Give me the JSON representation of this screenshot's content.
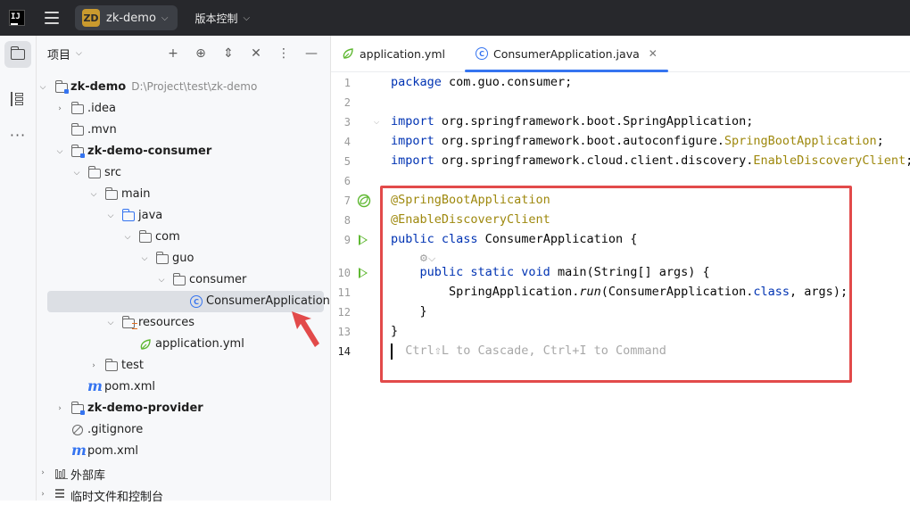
{
  "titlebar": {
    "logo": "IJ",
    "project_badge": "ZD",
    "project_name": "zk-demo",
    "vcs_label": "版本控制"
  },
  "panel": {
    "title": "项目"
  },
  "tree": [
    {
      "label": "zk-demo",
      "path": "D:\\Project\\test\\zk-demo"
    },
    {
      "label": ".idea"
    },
    {
      "label": ".mvn"
    },
    {
      "label": "zk-demo-consumer"
    },
    {
      "label": "src"
    },
    {
      "label": "main"
    },
    {
      "label": "java"
    },
    {
      "label": "com"
    },
    {
      "label": "guo"
    },
    {
      "label": "consumer"
    },
    {
      "label": "ConsumerApplication"
    },
    {
      "label": "resources"
    },
    {
      "label": "application.yml"
    },
    {
      "label": "test"
    },
    {
      "label": "pom.xml"
    },
    {
      "label": "zk-demo-provider"
    },
    {
      "label": ".gitignore"
    },
    {
      "label": "pom.xml"
    },
    {
      "label": "外部库"
    },
    {
      "label": "临时文件和控制台"
    }
  ],
  "tabs": [
    {
      "label": "application.yml"
    },
    {
      "label": "ConsumerApplication.java"
    }
  ],
  "code": {
    "lines": [
      {
        "n": "1",
        "parts": [
          {
            "t": "package",
            "c": "kw"
          },
          {
            "t": " com.guo.consumer;"
          }
        ]
      },
      {
        "n": "2",
        "parts": []
      },
      {
        "n": "3",
        "parts": [
          {
            "t": "import",
            "c": "kw"
          },
          {
            "t": " org.springframework.boot.SpringApplication;"
          }
        ]
      },
      {
        "n": "4",
        "parts": [
          {
            "t": "import",
            "c": "kw"
          },
          {
            "t": " org.springframework.boot.autoconfigure."
          },
          {
            "t": "SpringBootApplication",
            "c": "ann"
          },
          {
            "t": ";"
          }
        ]
      },
      {
        "n": "5",
        "parts": [
          {
            "t": "import",
            "c": "kw"
          },
          {
            "t": " org.springframework.cloud.client.discovery."
          },
          {
            "t": "EnableDiscoveryClient",
            "c": "ann"
          },
          {
            "t": ";"
          }
        ]
      },
      {
        "n": "6",
        "parts": []
      },
      {
        "n": "7",
        "parts": [
          {
            "t": "@SpringBootApplication",
            "c": "ann"
          }
        ]
      },
      {
        "n": "8",
        "parts": [
          {
            "t": "@EnableDiscoveryClient",
            "c": "ann"
          }
        ]
      },
      {
        "n": "9",
        "parts": [
          {
            "t": "public class",
            "c": "kw"
          },
          {
            "t": " ConsumerApplication {"
          }
        ]
      },
      {
        "n": "",
        "parts": []
      },
      {
        "n": "10",
        "parts": [
          {
            "t": "    "
          },
          {
            "t": "public static void",
            "c": "kw"
          },
          {
            "t": " main(String[] args) {"
          }
        ]
      },
      {
        "n": "11",
        "parts": [
          {
            "t": "        SpringApplication."
          },
          {
            "t": "run",
            "c": "it"
          },
          {
            "t": "(ConsumerApplication."
          },
          {
            "t": "class",
            "c": "kw"
          },
          {
            "t": ", args);"
          }
        ]
      },
      {
        "n": "12",
        "parts": [
          {
            "t": "    }"
          }
        ]
      },
      {
        "n": "13",
        "parts": [
          {
            "t": "}"
          }
        ]
      },
      {
        "n": "14",
        "parts": [
          {
            "t": "  Ctrl⇧L to Cascade, Ctrl+I to Command",
            "c": "hint"
          }
        ]
      }
    ]
  },
  "colors": {
    "accent": "#3574f0",
    "annotation_red": "#e24a4a",
    "run_green": "#5fb832"
  }
}
